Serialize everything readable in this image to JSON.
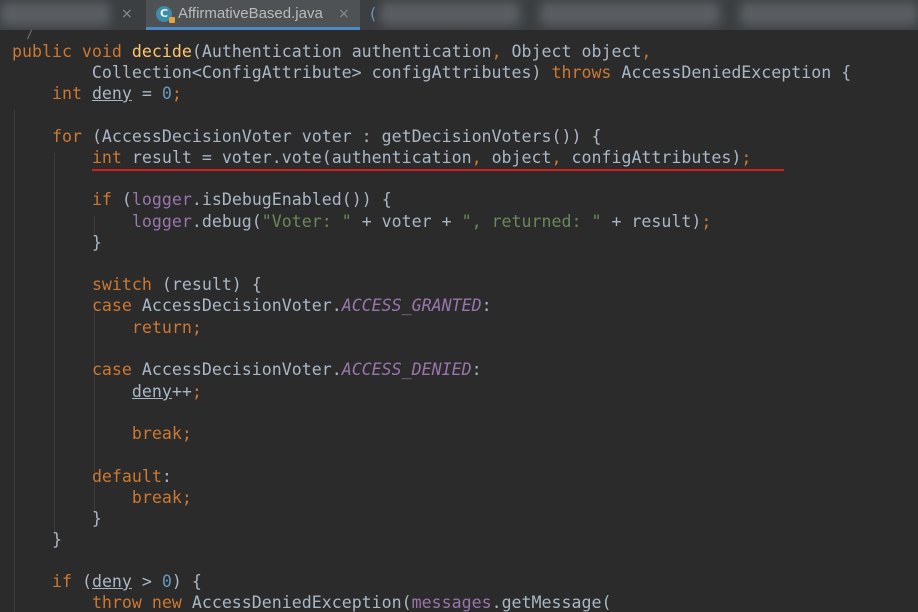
{
  "tabs": {
    "active_label": "AffirmativeBased.java",
    "active_icon": "java-class-icon",
    "icon_letter": "C",
    "close_glyph": "×",
    "next_tab_fragment": "("
  },
  "colors": {
    "background": "#2b2b2b",
    "keyword": "#cc7832",
    "method": "#ffc66d",
    "number": "#6897bb",
    "string": "#6a8759",
    "field": "#9876aa",
    "text": "#a9b7c6",
    "error_underline": "#d11e1e",
    "active_tab_accent": "#4a88c7"
  },
  "code": {
    "top_fragment": "/",
    "l1": {
      "a": "public void ",
      "b": "decide",
      "c": "(Authentication authentication",
      "d": ", ",
      "e": "Object object",
      "f": ","
    },
    "l2": {
      "a": "        Collection<ConfigAttribute> configAttributes) ",
      "b": "throws ",
      "c": "AccessDeniedException {"
    },
    "l3": {
      "a": "    ",
      "b": "int ",
      "c": "deny",
      "d": " = ",
      "e": "0",
      "f": ";"
    },
    "l5": {
      "a": "    ",
      "b": "for ",
      "c": "(AccessDecisionVoter voter : getDecisionVoters()) {"
    },
    "l6": {
      "a": "        ",
      "b": "int ",
      "c": "result = voter.vote(authentication",
      "d": ", ",
      "e": "object",
      "f": ", ",
      "g": "configAttributes)",
      "h": ";"
    },
    "l8": {
      "a": "        ",
      "b": "if ",
      "c": "(",
      "d": "logger",
      "e": ".isDebugEnabled()) {"
    },
    "l9": {
      "a": "            ",
      "b": "logger",
      "c": ".debug(",
      "d": "\"Voter: \" ",
      "e": "+ voter + ",
      "f": "\", returned: \" ",
      "g": "+ result)",
      "h": ";"
    },
    "l10": {
      "a": "        }"
    },
    "l12": {
      "a": "        ",
      "b": "switch ",
      "c": "(result) {"
    },
    "l13": {
      "a": "        ",
      "b": "case ",
      "c": "AccessDecisionVoter.",
      "d": "ACCESS_GRANTED",
      "e": ":"
    },
    "l14": {
      "a": "            ",
      "b": "return;"
    },
    "l16": {
      "a": "        ",
      "b": "case ",
      "c": "AccessDecisionVoter.",
      "d": "ACCESS_DENIED",
      "e": ":"
    },
    "l17": {
      "a": "            ",
      "b": "deny",
      "c": "++",
      "d": ";"
    },
    "l19": {
      "a": "            ",
      "b": "break;"
    },
    "l21": {
      "a": "        ",
      "b": "default",
      "c": ":"
    },
    "l22": {
      "a": "            ",
      "b": "break;"
    },
    "l23": {
      "a": "        }"
    },
    "l24": {
      "a": "    }"
    },
    "l26": {
      "a": "    ",
      "b": "if ",
      "c": "(",
      "d": "deny",
      "e": " > ",
      "f": "0",
      "g": ") {"
    },
    "l27": {
      "a": "        ",
      "b": "throw new ",
      "c": "AccessDeniedException(",
      "d": "messages",
      "e": ".getMessage("
    }
  }
}
